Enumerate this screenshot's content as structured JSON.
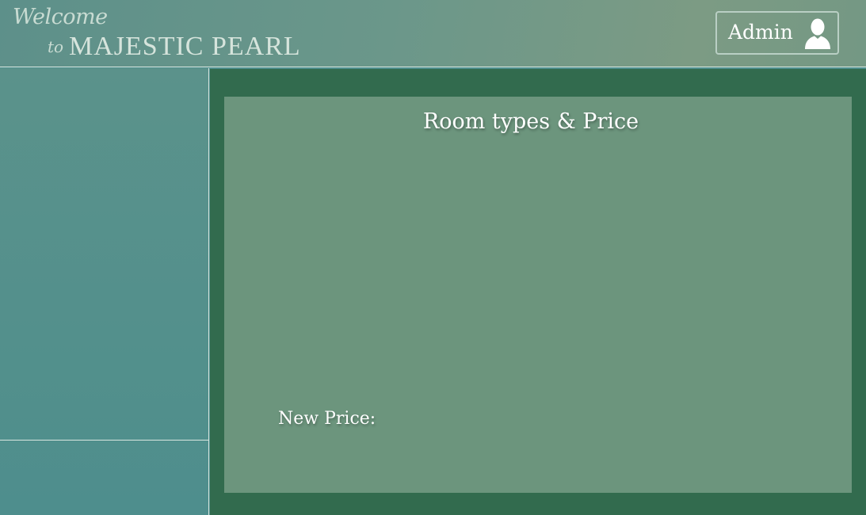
{
  "header": {
    "brand_welcome": "Welcome",
    "brand_to": "to",
    "brand_name": "MAJESTIC PEARL",
    "admin_label": "Admin",
    "admin_icon": "user-icon"
  },
  "main": {
    "title": "Room types & Price",
    "new_price_label": "New Price:"
  },
  "colors": {
    "main_bg": "#326b4e",
    "panel_bg": "#6c957d",
    "sidebar_bg": "#53908c"
  }
}
